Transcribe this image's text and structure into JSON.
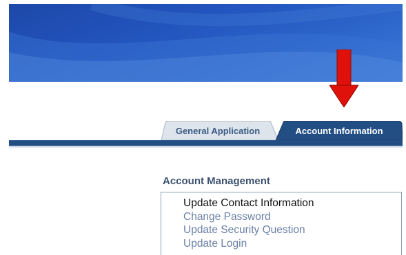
{
  "tabs": [
    {
      "label": "General Application",
      "active": false
    },
    {
      "label": "Account Information",
      "active": true
    }
  ],
  "account_management": {
    "title": "Account Management",
    "items": [
      {
        "label": "Update Contact Information",
        "active": true
      },
      {
        "label": "Change Password",
        "active": false
      },
      {
        "label": "Update Security Question",
        "active": false
      },
      {
        "label": "Update Login",
        "active": false
      }
    ]
  },
  "annotation": {
    "icon": "down-arrow-icon",
    "color": "#e0110b"
  },
  "colors": {
    "banner_blue": "#2254bd",
    "tab_dark": "#234e84",
    "tab_light": "#d9e1ea",
    "link": "#6b80a6",
    "title": "#3c5170"
  }
}
